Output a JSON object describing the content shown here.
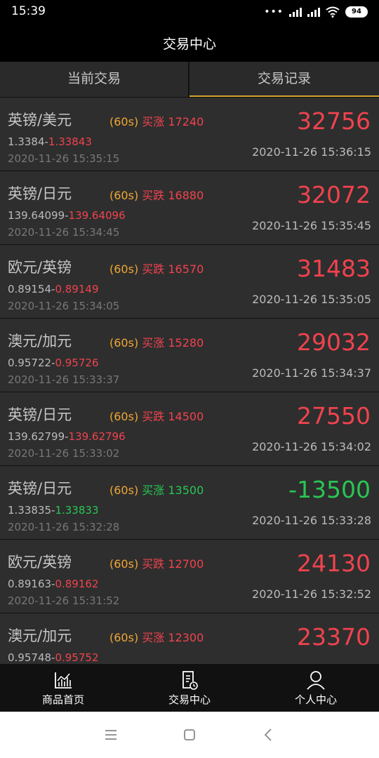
{
  "status": {
    "time": "15:39",
    "battery": "94",
    "network": "HD"
  },
  "header": {
    "title": "交易中心"
  },
  "tabs": [
    {
      "label": "当前交易",
      "active": false
    },
    {
      "label": "交易记录",
      "active": true
    }
  ],
  "trades": [
    {
      "pair": "英镑/美元",
      "period": "(60s)",
      "action": "买涨 17240",
      "open_price": "1.3384-",
      "close_price": "1.33843",
      "direction": "up",
      "open_time": "2020-11-26 15:35:15",
      "profit": "32756",
      "close_time": "2020-11-26 15:36:15"
    },
    {
      "pair": "英镑/日元",
      "period": "(60s)",
      "action": "买跌 16880",
      "open_price": "139.64099-",
      "close_price": "139.64096",
      "direction": "up",
      "open_time": "2020-11-26 15:34:45",
      "profit": "32072",
      "close_time": "2020-11-26 15:35:45"
    },
    {
      "pair": "欧元/英镑",
      "period": "(60s)",
      "action": "买跌 16570",
      "open_price": "0.89154-",
      "close_price": "0.89149",
      "direction": "up",
      "open_time": "2020-11-26 15:34:05",
      "profit": "31483",
      "close_time": "2020-11-26 15:35:05"
    },
    {
      "pair": "澳元/加元",
      "period": "(60s)",
      "action": "买涨 15280",
      "open_price": "0.95722-",
      "close_price": "0.95726",
      "direction": "up",
      "open_time": "2020-11-26 15:33:37",
      "profit": "29032",
      "close_time": "2020-11-26 15:34:37"
    },
    {
      "pair": "英镑/日元",
      "period": "(60s)",
      "action": "买跌 14500",
      "open_price": "139.62799-",
      "close_price": "139.62796",
      "direction": "up",
      "open_time": "2020-11-26 15:33:02",
      "profit": "27550",
      "close_time": "2020-11-26 15:34:02"
    },
    {
      "pair": "英镑/日元",
      "period": "(60s)",
      "action": "买涨 13500",
      "open_price": "1.33835-",
      "close_price": "1.33833",
      "direction": "down",
      "open_time": "2020-11-26 15:32:28",
      "profit": "-13500",
      "close_time": "2020-11-26 15:33:28"
    },
    {
      "pair": "欧元/英镑",
      "period": "(60s)",
      "action": "买跌 12700",
      "open_price": "0.89163-",
      "close_price": "0.89162",
      "direction": "up",
      "open_time": "2020-11-26 15:31:52",
      "profit": "24130",
      "close_time": "2020-11-26 15:32:52"
    },
    {
      "pair": "澳元/加元",
      "period": "(60s)",
      "action": "买涨 12300",
      "open_price": "0.95748-",
      "close_price": "0.95752",
      "direction": "up",
      "open_time": "",
      "profit": "23370",
      "close_time": ""
    }
  ],
  "nav": [
    {
      "label": "商品首页",
      "icon": "chart-icon"
    },
    {
      "label": "交易中心",
      "icon": "document-clock-icon"
    },
    {
      "label": "个人中心",
      "icon": "person-icon"
    }
  ],
  "colors": {
    "profit": "#f0434e",
    "loss": "#28c653",
    "period": "#f0a733",
    "tab_accent": "#d4a32a"
  }
}
